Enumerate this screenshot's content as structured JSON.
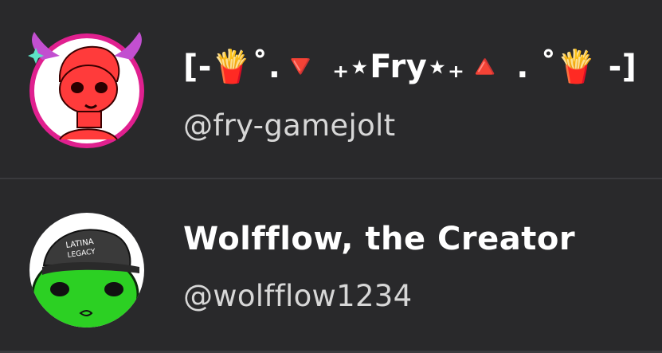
{
  "users": [
    {
      "display_name": "[-🍟˚.🔻 ₊⋆Fry⋆₊🔺 . ˚🍟 -]",
      "handle": "@fry-gamejolt"
    },
    {
      "display_name": "Wolfflow, the Creator",
      "handle": "@wolfflow1234",
      "avatar_cap_text_line1": "LATINA",
      "avatar_cap_text_line2": "LEGACY"
    }
  ],
  "colors": {
    "background": "#29292b",
    "divider": "#3a3a3d",
    "display_name": "#ffffff",
    "handle": "#d7d7d7"
  }
}
